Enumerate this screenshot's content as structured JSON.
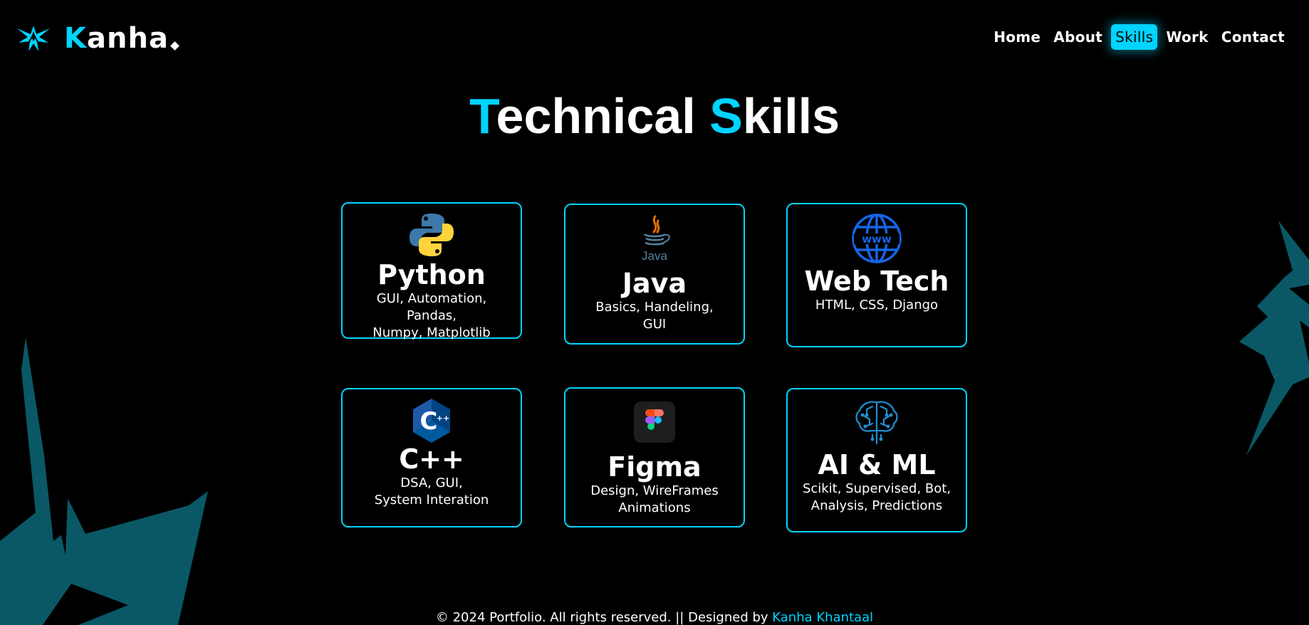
{
  "header": {
    "logo": {
      "initial": "K",
      "rest": "anha",
      "icon": "star-burst-logo-icon"
    },
    "nav": [
      {
        "label": "Home",
        "active": false
      },
      {
        "label": "About",
        "active": false
      },
      {
        "label": "Skills",
        "active": true
      },
      {
        "label": "Work",
        "active": false
      },
      {
        "label": "Contact",
        "active": false
      }
    ]
  },
  "section": {
    "title_a_initial": "T",
    "title_a_rest": "echnical ",
    "title_b_initial": "S",
    "title_b_rest": "kills"
  },
  "skills": [
    {
      "title": "Python",
      "desc_line1": "GUI, Automation, Pandas,",
      "desc_line2": "Numpy, Matplotlib",
      "icon": "python-icon"
    },
    {
      "title": "Java",
      "desc_line1": "Basics, Handeling,",
      "desc_line2": "GUI",
      "icon": "java-icon",
      "icon_text": "Java"
    },
    {
      "title": "Web Tech",
      "desc_line1": "HTML, CSS, Django",
      "desc_line2": "",
      "icon": "globe-www-icon",
      "icon_text": "www"
    },
    {
      "title": "C++",
      "desc_line1": "DSA, GUI,",
      "desc_line2": "System Interation",
      "icon": "cplusplus-icon",
      "icon_text": "C",
      "icon_sup": "++"
    },
    {
      "title": "Figma",
      "desc_line1": "Design, WireFrames",
      "desc_line2": "Animations",
      "icon": "figma-icon"
    },
    {
      "title": "AI & ML",
      "desc_line1": "Scikit, Supervised, Bot,",
      "desc_line2": "Analysis, Predictions",
      "icon": "brain-circuit-icon"
    }
  ],
  "footer": {
    "text": "© 2024 Portfolio. All rights reserved. || Designed by ",
    "link": "Kanha Khantaal"
  },
  "colors": {
    "accent": "#00d4ff",
    "background": "#000000",
    "decor": "#0a5866"
  }
}
